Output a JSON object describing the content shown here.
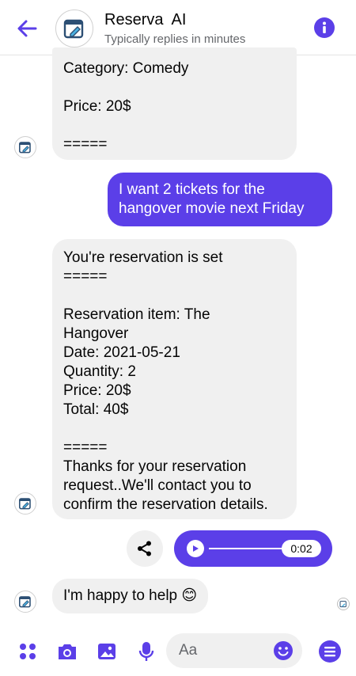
{
  "header": {
    "title": "Reserva  AI",
    "subtitle": "Typically replies in minutes"
  },
  "messages": {
    "prev_bot": [
      "Category: Comedy",
      "",
      "Price: 20$",
      "",
      "====="
    ],
    "user": [
      "I want 2 tickets for the",
      "hangover movie next Friday"
    ],
    "bot_reply": [
      "You're reservation is set",
      "=====",
      "",
      "Reservation item: The",
      "Hangover",
      "Date: 2021-05-21",
      "Quantity: 2",
      "Price: 20$",
      "Total: 40$",
      "",
      "=====",
      "Thanks for your reservation",
      "request..We'll contact you to",
      "confirm the reservation details."
    ],
    "audio_time": "0:02",
    "bot_last": "I'm happy to help 😊"
  },
  "composer": {
    "placeholder": "Aa"
  },
  "colors": {
    "accent": "#5b3fe8",
    "bubble_in": "#f0f0f0"
  },
  "icons": [
    "back-arrow-icon",
    "info-icon",
    "share-icon",
    "play-icon",
    "apps-icon",
    "camera-icon",
    "image-icon",
    "mic-icon",
    "emoji-icon",
    "menu-icon"
  ]
}
